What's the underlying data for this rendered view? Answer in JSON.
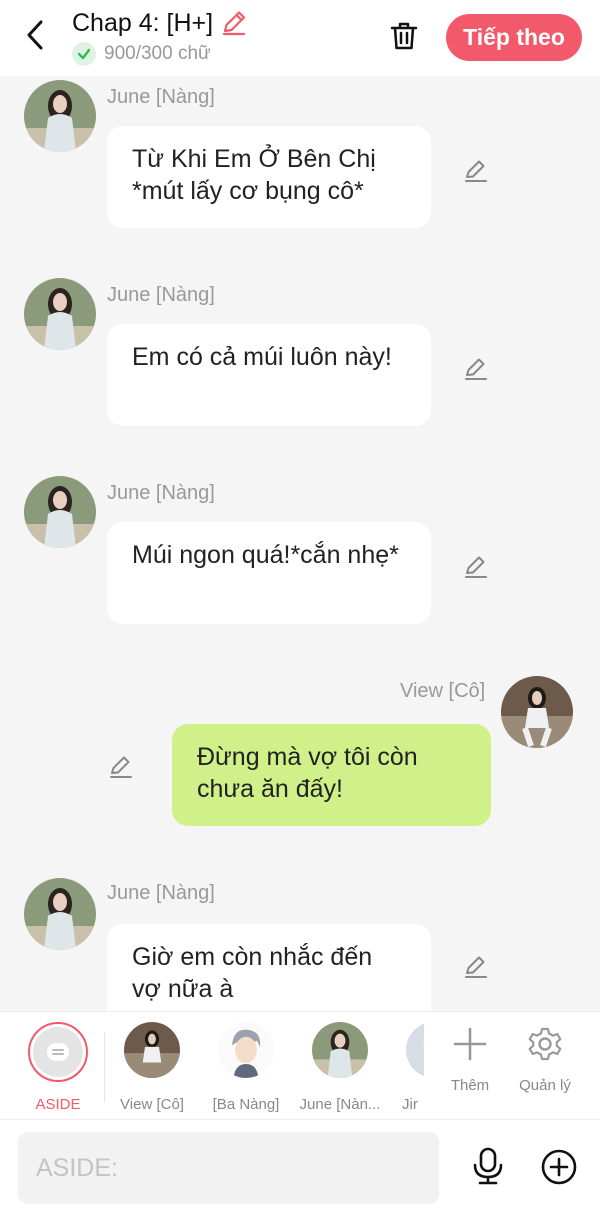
{
  "header": {
    "title": "Chap 4: [H+]",
    "word_count": "900/300 chữ",
    "next_label": "Tiếp theo",
    "accent_color": "#f2596b"
  },
  "messages": [
    {
      "sender": "June [Nàng]",
      "text": "Từ Khi Em Ở Bên Chị *mút lấy cơ bụng cô*",
      "side": "left"
    },
    {
      "sender": "June [Nàng]",
      "text": "Em có cả múi luôn này!",
      "side": "left"
    },
    {
      "sender": "June [Nàng]",
      "text": "Múi ngon quá!*cắn nhẹ*",
      "side": "left"
    },
    {
      "sender": "View [Cô]",
      "text": "Đừng mà vợ tôi còn chưa ăn đấy!",
      "side": "right"
    },
    {
      "sender": "June [Nàng]",
      "text": "Giờ em còn nhắc đến vợ nữa à",
      "side": "left"
    }
  ],
  "characters": [
    {
      "label": "ASIDE"
    },
    {
      "label": "View [Cô]"
    },
    {
      "label": "[Ba Nàng]"
    },
    {
      "label": "June [Nàn..."
    },
    {
      "label": "Jir"
    }
  ],
  "tools": {
    "add_label": "Thêm",
    "manage_label": "Quản lý"
  },
  "composer": {
    "placeholder": "ASIDE:"
  }
}
